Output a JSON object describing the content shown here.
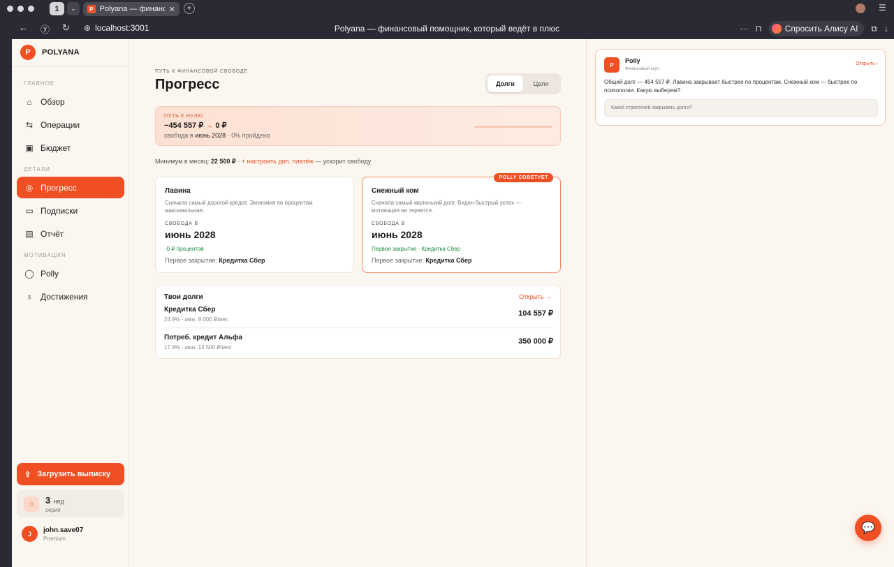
{
  "browser": {
    "tab_count": "1",
    "tab_favicon": "P",
    "tab_title": "Polyana — финансовый помощник",
    "url": "localhost:3001",
    "page_title": "Polyana — финансовый помощник, который ведёт в плюс",
    "alice_label": "Спросить Алису AI"
  },
  "sidebar": {
    "logo_mark": "P",
    "logo_text": "POLYANA",
    "sections": {
      "main": "ГЛАВНОЕ",
      "details": "ДЕТАЛИ",
      "motivation": "МОТИВАЦИЯ"
    },
    "items": [
      {
        "label": "Обзор",
        "icon": "home-icon"
      },
      {
        "label": "Операции",
        "icon": "swap-icon"
      },
      {
        "label": "Бюджет",
        "icon": "wallet-icon"
      },
      {
        "label": "Прогресс",
        "icon": "target-icon",
        "active": true
      },
      {
        "label": "Подписки",
        "icon": "card-icon"
      },
      {
        "label": "Отчёт",
        "icon": "document-icon"
      },
      {
        "label": "Polly",
        "icon": "chat-icon"
      },
      {
        "label": "Достижения",
        "icon": "medal-icon"
      }
    ],
    "upload_label": "Загрузить выписку",
    "streak": {
      "number": "3",
      "unit": "нед",
      "label": "серия"
    },
    "user": {
      "initial": "J",
      "name": "john.save07",
      "plan": "Premium"
    }
  },
  "main": {
    "eyebrow": "ПУТЬ К ФИНАНСОВОЙ СВОБОДЕ",
    "title": "Прогресс",
    "toggle": [
      "Долги",
      "Цели"
    ],
    "roadmap": {
      "label": "ПУТЬ К НУЛЮ",
      "from": "−454 557 ₽",
      "arrow": "→",
      "to": "0 ₽",
      "freedom_prefix": "свобода в",
      "freedom_date": "июнь 2028",
      "sep": "·",
      "progress_text": "0% пройдено",
      "progress": 0
    },
    "minimum": {
      "prefix": "Минимум в месяц:",
      "amount": "22 500 ₽",
      "sep": "·",
      "link": "+ настроить доп. платёж",
      "suffix": "— ускорит свободу"
    },
    "strategies": [
      {
        "title": "Лавина",
        "desc": "Сначала самый дорогой кредит. Экономия по процентам максимальная.",
        "freedom_label": "СВОБОДА В",
        "date": "июнь 2028",
        "gain": "-0 ₽ процентов",
        "first_label": "Первое закрытие:",
        "first_value": "Кредитка Сбер"
      },
      {
        "title": "Снежный ком",
        "desc": "Сначала самый маленький долг. Виден быстрый успех — мотивация не теряется.",
        "freedom_label": "СВОБОДА В",
        "date": "июнь 2028",
        "gain": "Первое закрытие · Кредитка Сбер",
        "first_label": "Первое закрытие:",
        "first_value": "Кредитка Сбер",
        "badge": "POLLY СОВЕТУЕТ"
      }
    ],
    "debts": {
      "title": "Твои долги",
      "open": "Открыть →",
      "rows": [
        {
          "name": "Кредитка Сбер",
          "meta": "24.9% · мин. 8 000 ₽/мес",
          "amount": "104 557 ₽"
        },
        {
          "name": "Потреб. кредит Альфа",
          "meta": "17.9% · мин. 14 500 ₽/мес",
          "amount": "350 000 ₽"
        }
      ]
    }
  },
  "coach": {
    "avatar": "P",
    "name": "Polly",
    "role": "Финансовый коуч",
    "open": "Открыть ›",
    "message": "Общий долг — 454 557 ₽. Лавина закрывает быстрее по процентам, Снежный ком — быстрее по психологии. Какую выберем?",
    "ask": "Какой стратегией закрывать долги?"
  },
  "colors": {
    "accent": "#f04e23",
    "background": "#fbf6ef",
    "positive": "#1f8a3a"
  }
}
